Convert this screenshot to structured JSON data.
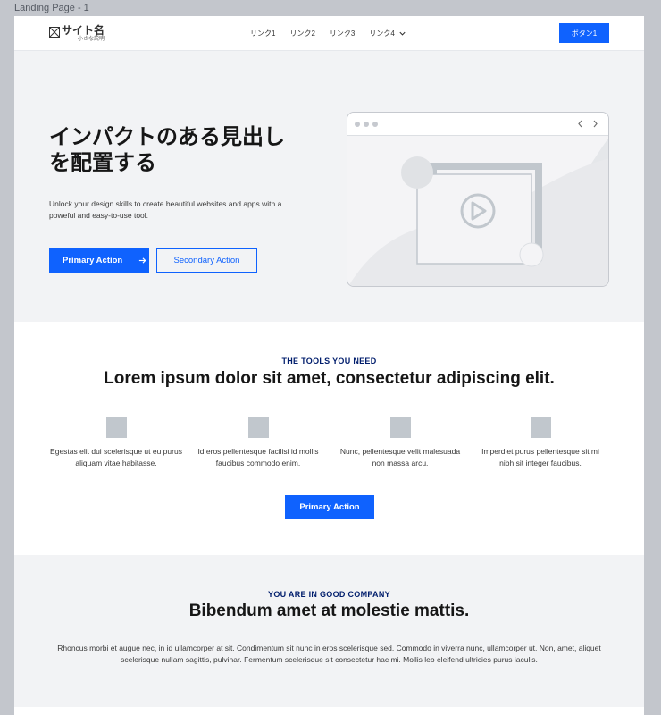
{
  "frame": {
    "label": "Landing Page - 1"
  },
  "nav": {
    "brand_name": "サイト名",
    "brand_sub": "小さな説明",
    "links": [
      "リンク1",
      "リンク2",
      "リンク3",
      "リンク4"
    ],
    "button": "ボタン1"
  },
  "hero": {
    "title_line1": "インパクトのある見出し",
    "title_line2": "を配置する",
    "description": "Unlock your design skills to create beautiful websites and apps with a poweful and easy-to-use tool.",
    "primary": "Primary Action",
    "secondary": "Secondary Action"
  },
  "tools": {
    "eyebrow": "THE TOOLS YOU NEED",
    "heading": "Lorem ipsum dolor sit amet, consectetur adipiscing elit.",
    "features": [
      "Egestas elit dui scelerisque ut eu purus aliquam vitae habitasse.",
      "Id eros pellentesque facilisi id mollis faucibus commodo enim.",
      "Nunc, pellentesque velit malesuada non massa arcu.",
      "Imperdiet purus pellentesque sit mi nibh sit integer faucibus."
    ],
    "button": "Primary Action"
  },
  "company": {
    "eyebrow": "YOU ARE IN GOOD COMPANY",
    "heading": "Bibendum amet at molestie mattis.",
    "body": "Rhoncus morbi et augue nec, in id ullamcorper at sit. Condimentum sit nunc in eros scelerisque sed. Commodo in viverra nunc, ullamcorper ut. Non, amet, aliquet scelerisque nullam sagittis, pulvinar. Fermentum scelerisque sit consectetur hac mi. Mollis leo eleifend ultricies purus iaculis."
  },
  "colors": {
    "accent": "#0f62fe",
    "eyebrow": "#001d6c",
    "section_bg": "#f2f3f5"
  },
  "icons": [
    "image-placeholder-icon",
    "chevron-down-icon",
    "arrow-right-icon",
    "chevron-left-icon",
    "chevron-right-icon",
    "play-icon"
  ]
}
